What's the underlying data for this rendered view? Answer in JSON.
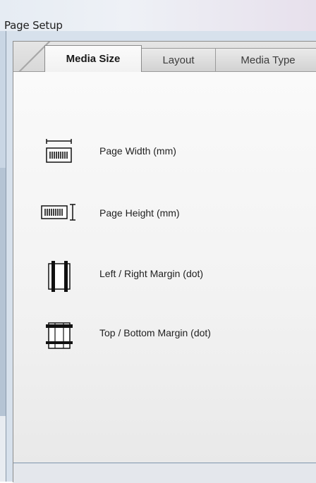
{
  "window": {
    "title": "Page Setup"
  },
  "tabs": [
    {
      "label": "Media Size",
      "active": true
    },
    {
      "label": "Layout",
      "active": false
    },
    {
      "label": "Media Type",
      "active": false
    }
  ],
  "settings": [
    {
      "label": "Page Width (mm)",
      "icon": "page-width-icon"
    },
    {
      "label": "Page Height (mm)",
      "icon": "page-height-icon"
    },
    {
      "label": "Left / Right Margin (dot)",
      "icon": "left-right-margin-icon"
    },
    {
      "label": "Top / Bottom Margin (dot)",
      "icon": "top-bottom-margin-icon"
    }
  ],
  "colors": {
    "panel_bg": "#f4f5f7",
    "frame_bg": "#d7e1ec",
    "accent_border": "#7f95ac"
  }
}
